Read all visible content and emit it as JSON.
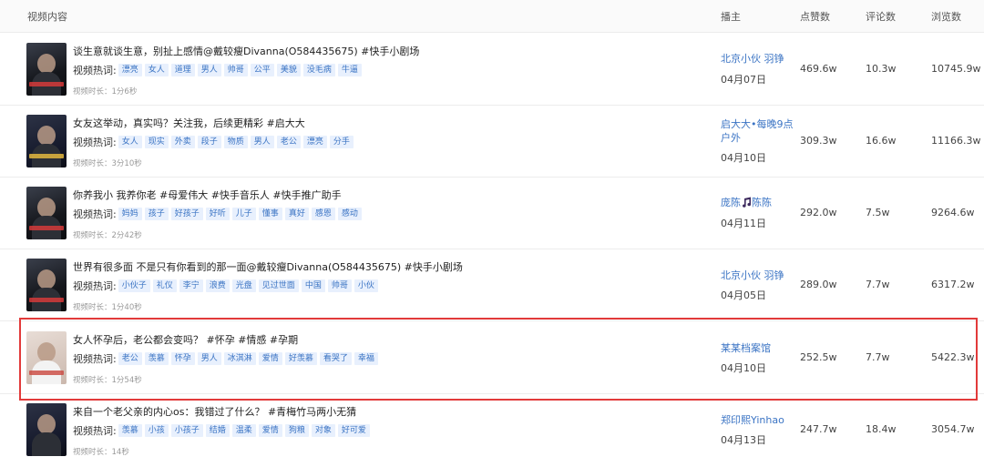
{
  "header": {
    "content": "视频内容",
    "author": "播主",
    "likes": "点赞数",
    "comments": "评论数",
    "views": "浏览数"
  },
  "rows": [
    {
      "title": "谈生意就谈生意，别扯上感情@戴较瘦Divanna(O584435675) #快手小剧场",
      "tags_label": "视频热词:",
      "tags": [
        "漂亮",
        "女人",
        "道理",
        "男人",
        "帅哥",
        "公平",
        "美貌",
        "没毛病",
        "牛逼"
      ],
      "duration": "视频时长：1分6秒",
      "author": "北京小伙 羽铮",
      "date": "04月07日",
      "likes": "469.6w",
      "comments": "10.3w",
      "views": "10745.9w"
    },
    {
      "title": "女友这举动，真实吗？关注我，后续更精彩 #启大大",
      "tags_label": "视频热词:",
      "tags": [
        "女人",
        "现实",
        "外卖",
        "段子",
        "物质",
        "男人",
        "老公",
        "漂亮",
        "分手"
      ],
      "duration": "视频时长：3分10秒",
      "author": "启大大•每晚9点户外",
      "date": "04月10日",
      "likes": "309.3w",
      "comments": "16.6w",
      "views": "11166.3w"
    },
    {
      "title": "你养我小 我养你老 #母爱伟大 #快手音乐人 #快手推广助手",
      "tags_label": "视频热词:",
      "tags": [
        "妈妈",
        "孩子",
        "好孩子",
        "好听",
        "儿子",
        "懂事",
        "真好",
        "感恩",
        "感动"
      ],
      "duration": "视频时长：2分42秒",
      "author_pre": "庞陈",
      "author_post": "陈陈",
      "date": "04月11日",
      "likes": "292.0w",
      "comments": "7.5w",
      "views": "9264.6w"
    },
    {
      "title": "世界有很多面 不是只有你看到的那一面@戴较瘦Divanna(O584435675) #快手小剧场",
      "tags_label": "视频热词:",
      "tags": [
        "小伙子",
        "礼仪",
        "李宁",
        "浪费",
        "光盘",
        "见过世面",
        "中国",
        "帅哥",
        "小伙"
      ],
      "duration": "视频时长：1分40秒",
      "author": "北京小伙 羽铮",
      "date": "04月05日",
      "likes": "289.0w",
      "comments": "7.7w",
      "views": "6317.2w"
    },
    {
      "title": "女人怀孕后，老公都会变吗？ #怀孕 #情感 #孕期",
      "tags_label": "视频热词:",
      "tags": [
        "老公",
        "羡慕",
        "怀孕",
        "男人",
        "冰淇淋",
        "爱情",
        "好羡慕",
        "看哭了",
        "幸福"
      ],
      "duration": "视频时长：1分54秒",
      "author": "某某档案馆",
      "date": "04月10日",
      "likes": "252.5w",
      "comments": "7.7w",
      "views": "5422.3w"
    },
    {
      "title": "来自一个老父亲的内心os：我错过了什么？ #青梅竹马两小无猜",
      "tags_label": "视频热词:",
      "tags": [
        "羡慕",
        "小孩",
        "小孩子",
        "结婚",
        "温柔",
        "爱情",
        "狗粮",
        "对象",
        "好可爱"
      ],
      "duration": "视频时长：14秒",
      "author": "郑印熙Yinhao",
      "date": "04月13日",
      "likes": "247.7w",
      "comments": "18.4w",
      "views": "3054.7w"
    }
  ]
}
